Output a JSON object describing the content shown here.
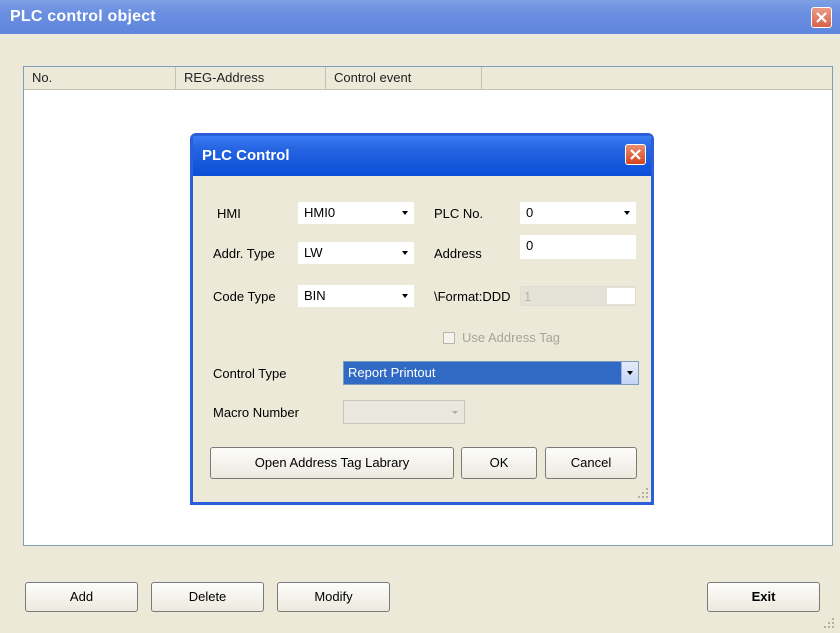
{
  "window": {
    "title": "PLC control object"
  },
  "list": {
    "columns": [
      "No.",
      "REG-Address",
      "Control event"
    ]
  },
  "buttons": {
    "add": "Add",
    "delete": "Delete",
    "modify": "Modify",
    "exit": "Exit"
  },
  "dialog": {
    "title": "PLC Control",
    "hmi": {
      "label": "HMI",
      "value": "HMI0"
    },
    "plc_no": {
      "label": "PLC No.",
      "value": "0"
    },
    "addr_type": {
      "label": "Addr. Type",
      "value": "LW"
    },
    "address": {
      "label": "Address",
      "value": "0"
    },
    "code_type": {
      "label": "Code Type",
      "value": "BIN"
    },
    "format": {
      "label": "\\Format:DDD",
      "value": "1"
    },
    "use_address_tag": {
      "label": "Use Address Tag",
      "checked": false,
      "enabled": false
    },
    "control_type": {
      "label": "Control Type",
      "value": "Report Printout"
    },
    "macro_number": {
      "label": "Macro Number",
      "value": ""
    },
    "open_tag_library": "Open Address Tag Labrary",
    "ok": "OK",
    "cancel": "Cancel"
  },
  "colors": {
    "title_bar": "#6a8ee0",
    "dialog_title": "#2765e2",
    "selection": "#316ac5",
    "close": "#d9614a"
  }
}
